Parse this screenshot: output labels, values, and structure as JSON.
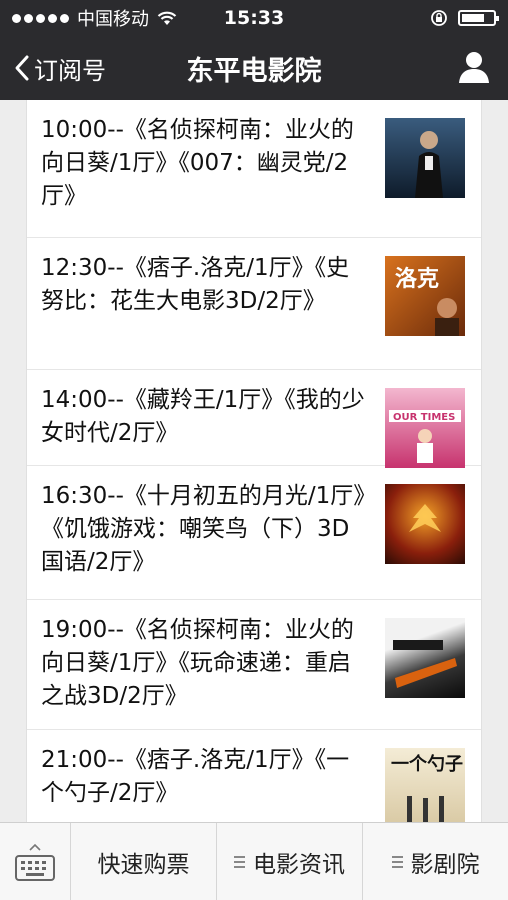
{
  "status": {
    "carrier": "中国移动",
    "time": "15:33"
  },
  "nav": {
    "back_label": "订阅号",
    "title": "东平电影院"
  },
  "showtimes": [
    {
      "text": "10:00--《名侦探柯南：业火的向日葵/1厅》《007：幽灵党/2厅》",
      "poster_icon": "poster-007-spectre",
      "poster_bg": "#1d3047"
    },
    {
      "text": "12:30--《痞子.洛克/1厅》《史努比：花生大电影3D/2厅》",
      "poster_icon": "poster-rock",
      "poster_bg": "#8a3b12"
    },
    {
      "text": "14:00--《藏羚王/1厅》《我的少女时代/2厅》",
      "poster_icon": "poster-our-times",
      "poster_bg": "#d64f8a"
    },
    {
      "text": "16:30--《十月初五的月光/1厅》《饥饿游戏：嘲笑鸟（下）3D国语/2厅》",
      "poster_icon": "poster-hunger-games",
      "poster_bg": "#a8301a"
    },
    {
      "text": "19:00--《名侦探柯南：业火的向日葵/1厅》《玩命速递：重启之战3D/2厅》",
      "poster_icon": "poster-transporter",
      "poster_bg": "#1c1c1c"
    },
    {
      "text": "21:00--《痞子.洛克/1厅》《一个勺子/2厅》",
      "poster_icon": "poster-a-fool",
      "poster_bg": "#e8e0cc"
    }
  ],
  "bottom": {
    "tab1": "快速购票",
    "tab2": "电影资讯",
    "tab3": "影剧院"
  }
}
